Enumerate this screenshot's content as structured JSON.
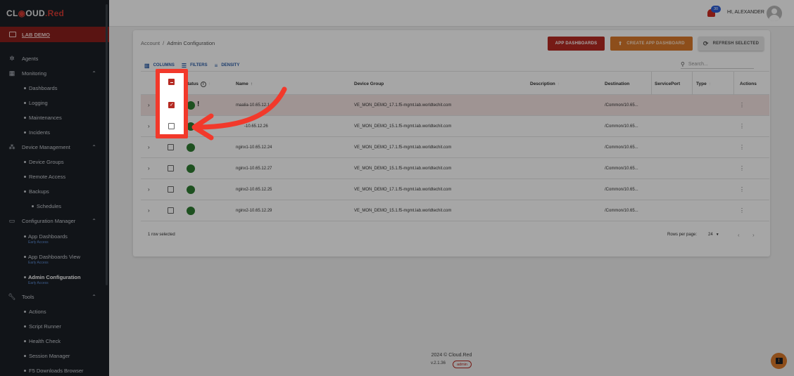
{
  "brand": {
    "prefix": "CL",
    "mid": "OUD",
    "suffix": ".Red",
    "full": "CLOUD.Red"
  },
  "sidebar": {
    "lab_label": "LAB DEMO",
    "items": [
      {
        "label": "Agents"
      },
      {
        "label": "Monitoring"
      },
      {
        "label": "Dashboards"
      },
      {
        "label": "Logging"
      },
      {
        "label": "Maintenances"
      },
      {
        "label": "Incidents"
      },
      {
        "label": "Device Management"
      },
      {
        "label": "Device Groups"
      },
      {
        "label": "Remote Access"
      },
      {
        "label": "Backups"
      },
      {
        "label": "Schedules"
      },
      {
        "label": "Configuration Manager"
      },
      {
        "label": "App Dashboards",
        "tag": "Early Access"
      },
      {
        "label": "App Dashboards View",
        "tag": "Early Access"
      },
      {
        "label": "Admin Configuration",
        "tag": "Early Access"
      },
      {
        "label": "Tools"
      },
      {
        "label": "Actions"
      },
      {
        "label": "Script Runner"
      },
      {
        "label": "Health Check"
      },
      {
        "label": "Session Manager"
      },
      {
        "label": "F5 Downloads Browser"
      }
    ]
  },
  "topbar": {
    "notifications": "30",
    "greeting": "HI, ALEXANDER"
  },
  "breadcrumb": {
    "root": "Account",
    "sep": "/",
    "current": "Admin Configuration"
  },
  "actions": {
    "app_dashboards": "APP DASHBOARDS",
    "create": "CREATE APP DASHBOARD",
    "refresh": "REFRESH SELECTED"
  },
  "toolbar": {
    "columns": "COLUMNS",
    "filters": "FILTERS",
    "density": "DENSITY",
    "search_placeholder": "Search..."
  },
  "table": {
    "headers": {
      "status": "Status",
      "name": "Name",
      "device_group": "Device Group",
      "description": "Description",
      "destination": "Destination",
      "service_port": "ServicePort",
      "type": "Type",
      "actions": "Actions"
    },
    "rows": [
      {
        "name": "maalia-10.65.12.1",
        "group": "VE_MON_DEMO_17.1.f5-mgmt.lab.worldtechit.com",
        "dest": "/Common/10.65...",
        "selected": true,
        "warning": "!"
      },
      {
        "name": "-10.65.12.26",
        "group": "VE_MON_DEMO_15.1.f5-mgmt.lab.worldtechit.com",
        "dest": "/Common/10.65...",
        "selected": false,
        "warning": ""
      },
      {
        "name": "nginx1-10.65.12.24",
        "group": "VE_MON_DEMO_17.1.f5-mgmt.lab.worldtechit.com",
        "dest": "/Common/10.65...",
        "selected": false,
        "warning": ""
      },
      {
        "name": "nginx1-10.65.12.27",
        "group": "VE_MON_DEMO_15.1.f5-mgmt.lab.worldtechit.com",
        "dest": "/Common/10.65...",
        "selected": false,
        "warning": ""
      },
      {
        "name": "nginx2-10.65.12.25",
        "group": "VE_MON_DEMO_17.1.f5-mgmt.lab.worldtechit.com",
        "dest": "/Common/10.65...",
        "selected": false,
        "warning": ""
      },
      {
        "name": "nginx2-10.65.12.29",
        "group": "VE_MON_DEMO_15.1.f5-mgmt.lab.worldtechit.com",
        "dest": "/Common/10.65...",
        "selected": false,
        "warning": ""
      }
    ],
    "footer": {
      "selected": "1 row selected",
      "rows_per_page_label": "Rows per page:",
      "rows_per_page": "24"
    }
  },
  "footer": {
    "copyright": "2024 © Cloud.Red",
    "version": "v.2.1.36",
    "role": "admin"
  },
  "colors": {
    "accent": "#b52a22",
    "annotation": "#f2392b",
    "sidebar": "#1b1f26",
    "status_ok": "#2e7d32"
  }
}
